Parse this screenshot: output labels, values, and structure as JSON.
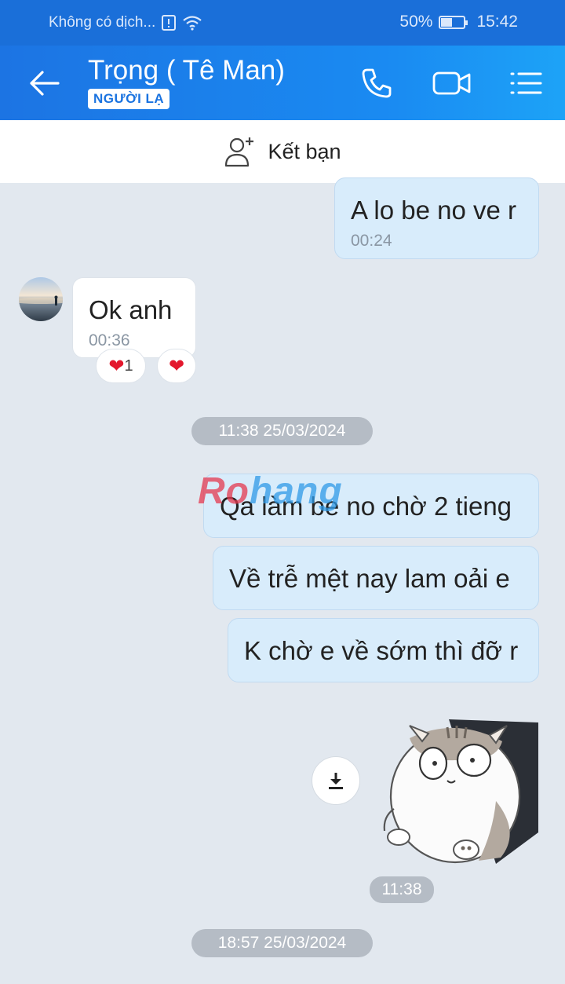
{
  "status_bar": {
    "carrier": "Không có dịch...",
    "battery": "50%",
    "battery_level": 0.5,
    "time": "15:42"
  },
  "header": {
    "title": "Trọng ( Tê Man)",
    "badge": "NGƯỜI LẠ",
    "accent": "#1a6fd9"
  },
  "add_friend": {
    "label": "Kết bạn"
  },
  "messages": [
    {
      "direction": "out",
      "text": "A lo be no ve r",
      "time": "00:24"
    },
    {
      "direction": "in",
      "text": "Ok anh",
      "time": "00:36",
      "reaction_count": "1"
    },
    {
      "direction": "out",
      "text": "Qa làm be no chờ 2 tieng"
    },
    {
      "direction": "out",
      "text": "Về trễ mệt nay lam oải e"
    },
    {
      "direction": "out",
      "text": "K chờ e về sớm thì đỡ r"
    }
  ],
  "separators": [
    "11:38 25/03/2024",
    "18:57 25/03/2024"
  ],
  "sticker": {
    "time": "11:38"
  },
  "watermark": {
    "part1": "Ro",
    "part2": "hang"
  }
}
